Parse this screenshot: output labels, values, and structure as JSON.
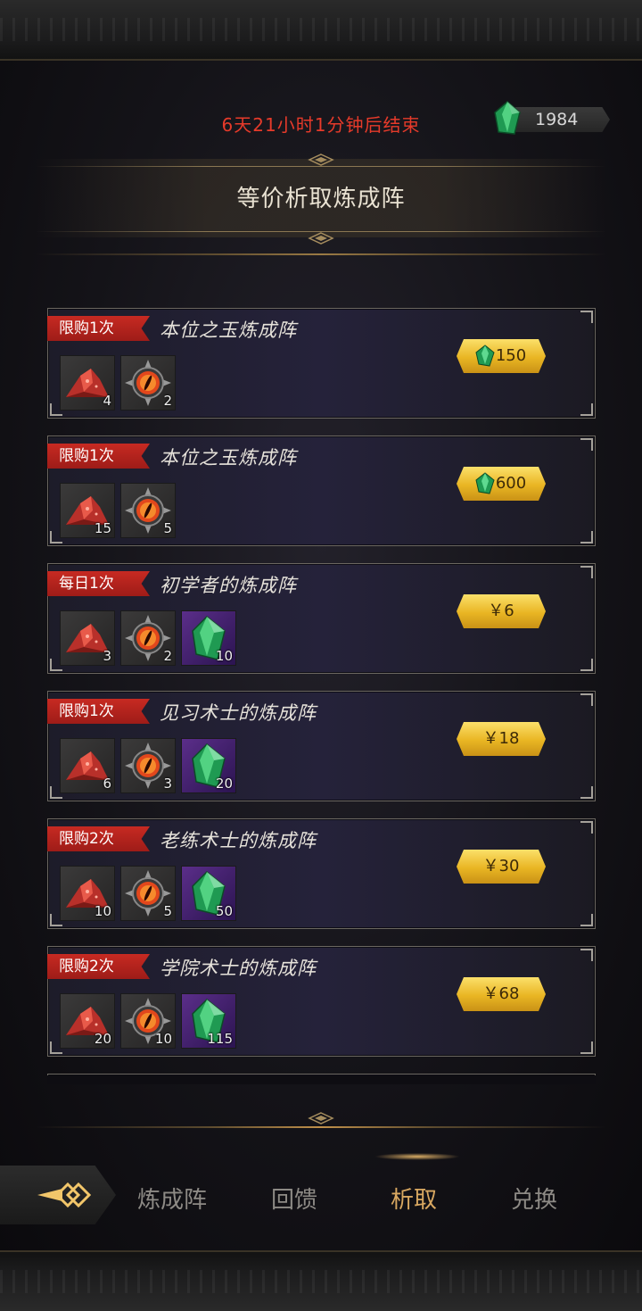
{
  "header": {
    "timer_text": "6天21小时1分钟后结束",
    "currency_amount": "1984",
    "currency_icon": "green-crystal-icon",
    "title": "等价析取炼成阵"
  },
  "offers": [
    {
      "tag": "限购1次",
      "name": "本位之玉炼成阵",
      "items": [
        {
          "icon": "red-ore-icon",
          "qty": "4"
        },
        {
          "icon": "fire-eye-orb-icon",
          "qty": "2"
        }
      ],
      "price": "150",
      "price_currency": "green-crystal-icon"
    },
    {
      "tag": "限购1次",
      "name": "本位之玉炼成阵",
      "items": [
        {
          "icon": "red-ore-icon",
          "qty": "15"
        },
        {
          "icon": "fire-eye-orb-icon",
          "qty": "5"
        }
      ],
      "price": "600",
      "price_currency": "green-crystal-icon"
    },
    {
      "tag": "每日1次",
      "name": "初学者的炼成阵",
      "items": [
        {
          "icon": "red-ore-icon",
          "qty": "3"
        },
        {
          "icon": "fire-eye-orb-icon",
          "qty": "2"
        },
        {
          "icon": "green-crystal-icon",
          "qty": "10"
        }
      ],
      "price": "￥6",
      "price_currency": "rmb"
    },
    {
      "tag": "限购1次",
      "name": "见习术士的炼成阵",
      "items": [
        {
          "icon": "red-ore-icon",
          "qty": "6"
        },
        {
          "icon": "fire-eye-orb-icon",
          "qty": "3"
        },
        {
          "icon": "green-crystal-icon",
          "qty": "20"
        }
      ],
      "price": "￥18",
      "price_currency": "rmb"
    },
    {
      "tag": "限购2次",
      "name": "老练术士的炼成阵",
      "items": [
        {
          "icon": "red-ore-icon",
          "qty": "10"
        },
        {
          "icon": "fire-eye-orb-icon",
          "qty": "5"
        },
        {
          "icon": "green-crystal-icon",
          "qty": "50"
        }
      ],
      "price": "￥30",
      "price_currency": "rmb"
    },
    {
      "tag": "限购2次",
      "name": "学院术士的炼成阵",
      "items": [
        {
          "icon": "red-ore-icon",
          "qty": "20"
        },
        {
          "icon": "fire-eye-orb-icon",
          "qty": "10"
        },
        {
          "icon": "green-crystal-icon",
          "qty": "115"
        }
      ],
      "price": "￥68",
      "price_currency": "rmb"
    }
  ],
  "nav": {
    "tabs": [
      "炼成阵",
      "回馈",
      "析取",
      "兑换"
    ],
    "active_tab": "析取",
    "back_icon": "back-arrow-icon"
  },
  "colors": {
    "timer": "#e63a2a",
    "tag": "#c72a22",
    "price_button": "#e9b523",
    "active_tab": "#d9a861"
  }
}
